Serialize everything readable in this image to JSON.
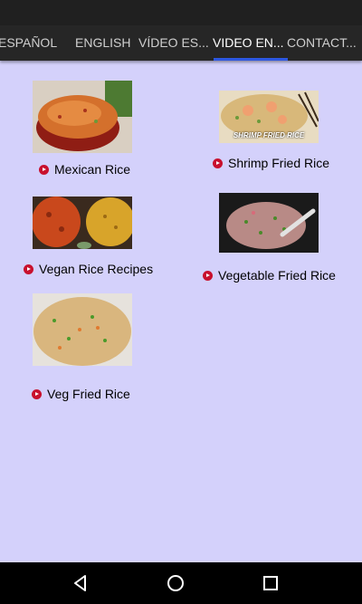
{
  "tabs": [
    {
      "label": "ESPAÑOL",
      "active": false
    },
    {
      "label": "ENGLISH",
      "active": false
    },
    {
      "label": "VÍDEO ES...",
      "active": false
    },
    {
      "label": "VIDEO EN...",
      "active": true
    },
    {
      "label": "CONTACT...",
      "active": false
    }
  ],
  "colors": {
    "background": "#d4d1fb",
    "tab_bar": "#262626",
    "tab_indicator": "#2d57e0",
    "play_icon": "#c8102e"
  },
  "videos": [
    {
      "title": "Mexican Rice",
      "icon": "video-play-icon"
    },
    {
      "title": "Shrimp Fried Rice",
      "icon": "video-play-icon",
      "thumbnail_text": "SHRIMP FRIED RICE"
    },
    {
      "title": "Vegan Rice Recipes",
      "icon": "video-play-icon"
    },
    {
      "title": "Vegetable Fried Rice",
      "icon": "video-play-icon"
    },
    {
      "title": "Veg Fried Rice",
      "icon": "video-play-icon"
    }
  ],
  "nav": {
    "back_icon": "back-icon",
    "home_icon": "home-icon",
    "recents_icon": "recents-icon"
  }
}
